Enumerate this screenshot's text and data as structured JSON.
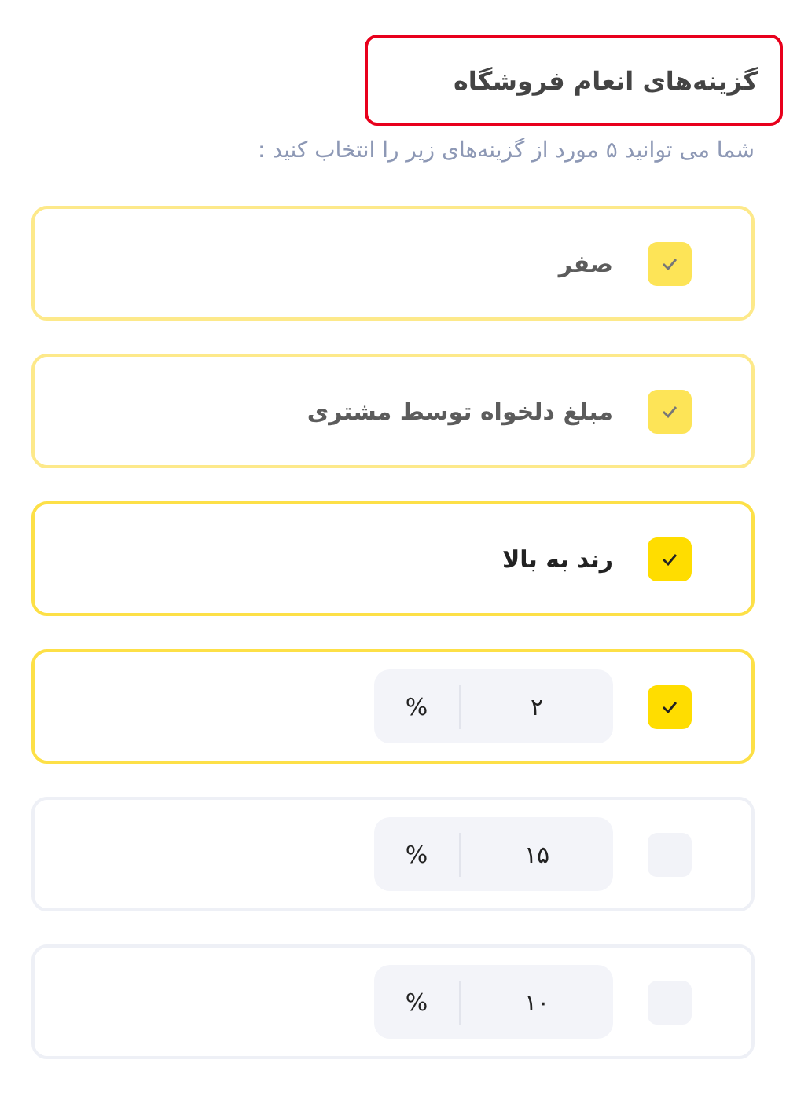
{
  "title": "گزینه‌های انعام فروشگاه",
  "subtitle": "شما می توانید ۵ مورد از گزینه‌های زیر را انتخاب کنید :",
  "options": [
    {
      "kind": "text",
      "label": "صفر",
      "checked": true,
      "disabled": true
    },
    {
      "kind": "text",
      "label": "مبلغ دلخواه توسط مشتری",
      "checked": true,
      "disabled": true
    },
    {
      "kind": "text",
      "label": "رند به بالا",
      "checked": true,
      "disabled": false
    },
    {
      "kind": "percent",
      "value": "۲",
      "unit": "%",
      "checked": true,
      "disabled": false
    },
    {
      "kind": "percent",
      "value": "۱۵",
      "unit": "%",
      "checked": false,
      "disabled": false
    },
    {
      "kind": "percent",
      "value": "۱۰",
      "unit": "%",
      "checked": false,
      "disabled": false
    }
  ]
}
